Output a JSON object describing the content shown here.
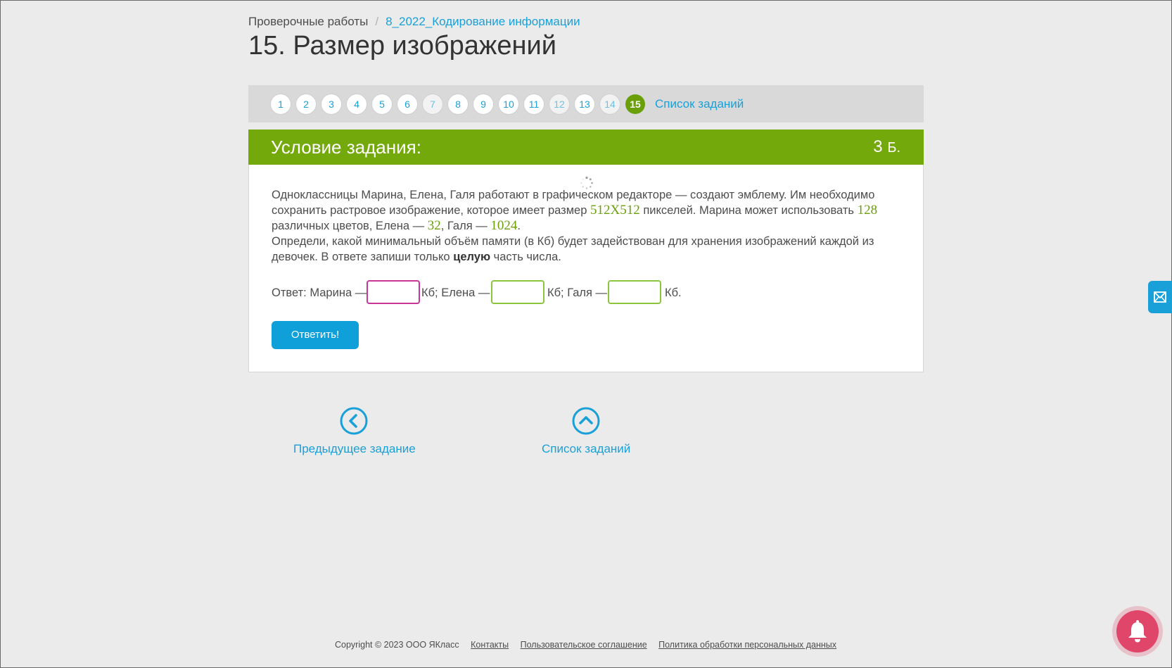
{
  "breadcrumb": {
    "root": "Проверочные работы",
    "separator": "/",
    "current": "8_2022_Кодирование информации"
  },
  "title": "15. Размер изображений",
  "pager": {
    "items": [
      "1",
      "2",
      "3",
      "4",
      "5",
      "6",
      "7",
      "8",
      "9",
      "10",
      "11",
      "12",
      "13",
      "14",
      "15"
    ],
    "active": "15",
    "list_label": "Список заданий"
  },
  "task": {
    "header_label": "Условие задания:",
    "points_value": "3",
    "points_unit": "Б.",
    "text": {
      "p1_a": "Одноклассницы Марина, Елена, Галя работают в графическом редакторе — создают эмблему. Им необходимо сохранить растровое изображение, которое имеет размер",
      "size": "512X512",
      "p1_b": "пикселей. Марина может использовать",
      "marina_colors": "128",
      "p1_c": "различных цветов, Елена —",
      "elena_colors": "32",
      "p1_d": ", Галя —",
      "galya_colors": "1024",
      "p1_e": ".",
      "p2_a": "Определи, какой минимальный объём памяти (в Кб) будет задействован для хранения изображений каждой из девочек. В ответе запиши только",
      "p2_bold": "целую",
      "p2_b": "часть числа."
    },
    "answer": {
      "prefix": "Ответ: Марина —",
      "sep1": "Кб;  Елена —",
      "sep2": "Кб; Галя —",
      "suffix": "Кб.",
      "marina_value": "",
      "elena_value": "",
      "galya_value": ""
    },
    "submit_label": "Ответить!"
  },
  "nav": {
    "prev_label": "Предыдущее задание",
    "list_label": "Список заданий"
  },
  "footer": {
    "copyright": "Copyright © 2023 ООО ЯКласс",
    "links": [
      "Контакты",
      "Пользовательское соглашение",
      "Политика обработки персональных данных"
    ]
  },
  "icons": {
    "prev": "chevron-left-circle-icon",
    "up": "chevron-up-circle-icon",
    "mail": "mail-icon",
    "bell": "bell-icon",
    "spinner": "loading-spinner-icon"
  },
  "colors": {
    "accent": "#1aa0d8",
    "header_green": "#73a90b",
    "active_green": "#6a9f0a",
    "button_blue": "#0fa0d9",
    "bell_pink": "#e0466a"
  }
}
